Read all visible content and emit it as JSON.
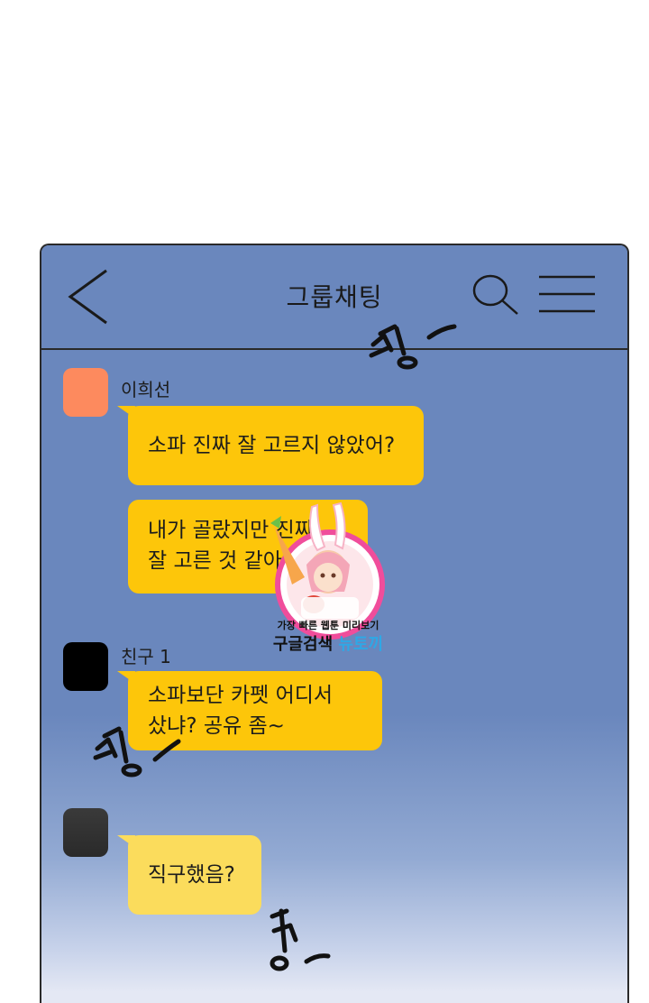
{
  "header": {
    "title": "그룹채팅",
    "back_icon": "chevron-left-icon",
    "search_icon": "search-icon",
    "menu_icon": "hamburger-menu-icon"
  },
  "messages": [
    {
      "sender": "이희선",
      "avatar_color": "#fd8a5e",
      "lines": [
        "소파 진짜 잘 고르지 않았어?"
      ]
    },
    {
      "sender": "",
      "lines": [
        "내가 골랐지만 진짜",
        "잘 고른 것 같아"
      ]
    },
    {
      "sender": "친구 1",
      "avatar_color": "#000000",
      "lines": [
        "소파보단 카펫 어디서",
        "샀냐? 공유 좀~"
      ]
    },
    {
      "sender": "",
      "avatar_color": "#333333",
      "lines": [
        "직구했음?"
      ]
    }
  ],
  "sound_effects": [
    "핑~",
    "핑~",
    "띵~"
  ],
  "watermark": {
    "line1": "가장 빠른 웹툰 미리보기",
    "line2_a": "구글검색",
    "line2_b": "뉴토끼"
  },
  "colors": {
    "chat_bg": "#6a87bd",
    "bubble": "#fdc60a"
  }
}
